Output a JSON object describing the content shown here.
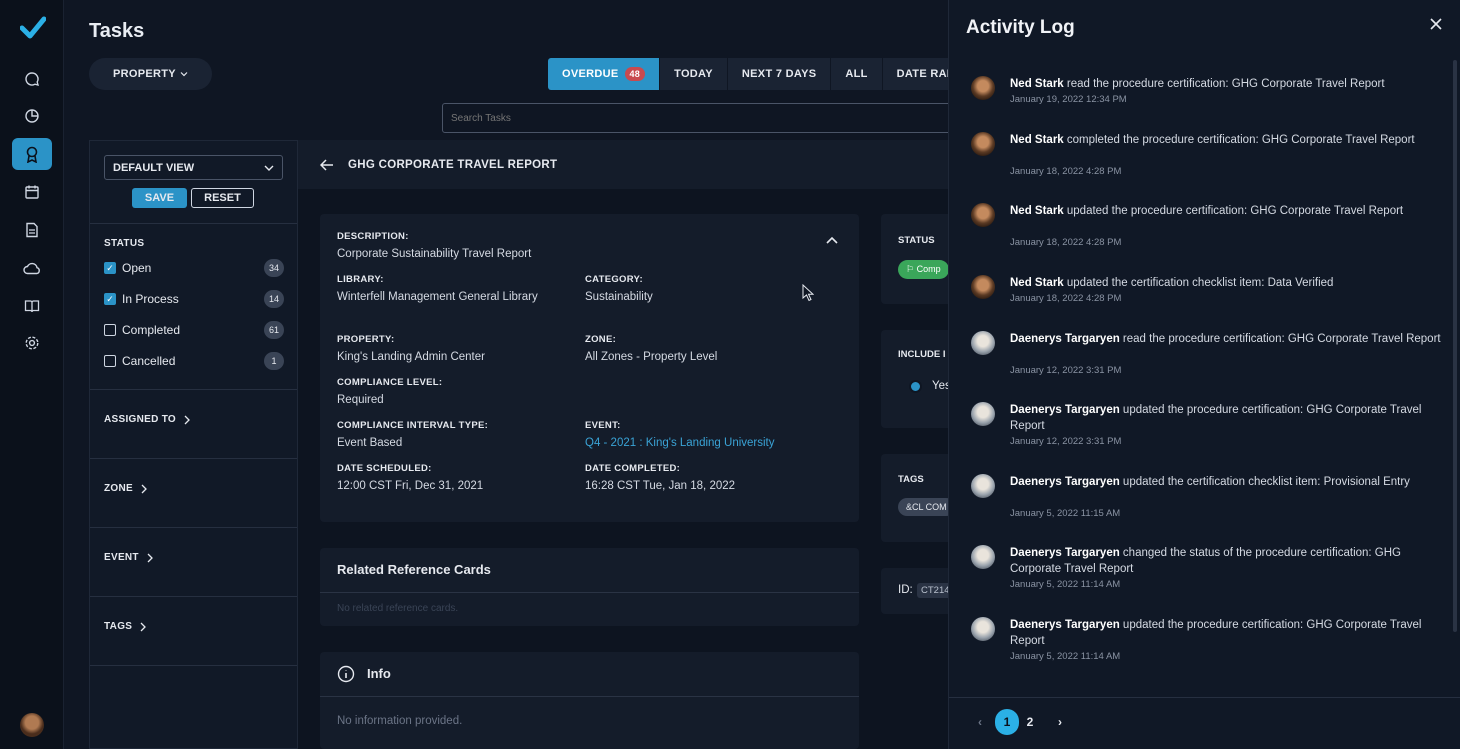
{
  "app": {
    "page_title": "Tasks",
    "property_label": "PROPERTY",
    "date_filters": {
      "overdue": "OVERDUE",
      "overdue_count": "48",
      "today": "TODAY",
      "next7": "NEXT 7 DAYS",
      "all": "ALL",
      "date_range": "DATE RANG"
    },
    "search_placeholder": "Search Tasks"
  },
  "filters": {
    "view": "DEFAULT VIEW",
    "save": "SAVE",
    "reset": "RESET",
    "status_heading": "STATUS",
    "statuses": [
      {
        "label": "Open",
        "count": "34",
        "checked": true
      },
      {
        "label": "In Process",
        "count": "14",
        "checked": true
      },
      {
        "label": "Completed",
        "count": "61",
        "checked": false
      },
      {
        "label": "Cancelled",
        "count": "1",
        "checked": false
      }
    ],
    "sections": {
      "assigned": "ASSIGNED TO",
      "zone": "ZONE",
      "event": "EVENT",
      "tags": "TAGS"
    }
  },
  "detail": {
    "title": "GHG CORPORATE TRAVEL REPORT",
    "description_label": "DESCRIPTION:",
    "description": "Corporate Sustainability Travel Report",
    "library_label": "LIBRARY:",
    "library": "Winterfell Management General Library",
    "category_label": "CATEGORY:",
    "category": "Sustainability",
    "property_label": "PROPERTY:",
    "property": "King's Landing Admin Center",
    "zone_label": "ZONE:",
    "zone": "All Zones - Property Level",
    "compliance_level_label": "COMPLIANCE LEVEL:",
    "compliance_level": "Required",
    "interval_label": "COMPLIANCE INTERVAL TYPE:",
    "interval": "Event Based",
    "event_label": "EVENT:",
    "event": "Q4 - 2021 : King's Landing University",
    "scheduled_label": "DATE SCHEDULED:",
    "scheduled": "12:00 CST Fri, Dec 31, 2021",
    "completed_label": "DATE COMPLETED:",
    "completed": "16:28 CST Tue, Jan 18, 2022",
    "related_heading": "Related Reference Cards",
    "related_empty": "No related reference cards.",
    "info_heading": "Info",
    "info_empty": "No information provided.",
    "side": {
      "status_label": "STATUS",
      "status_value": "Comp",
      "include_label": "INCLUDE I",
      "include_value": "Yes",
      "tags_label": "TAGS",
      "tag_value": "&CL COM",
      "id_label": "ID:",
      "id_value": "CT214"
    }
  },
  "activity": {
    "title": "Activity Log",
    "items": [
      {
        "user": "Ned Stark",
        "action": " read the procedure certification: GHG Corporate Travel Report",
        "time": "January 19, 2022 12:34 PM",
        "avatar": "ned"
      },
      {
        "user": "Ned Stark",
        "action": " completed the procedure certification: GHG Corporate Travel Report",
        "time": "January 18, 2022 4:28 PM",
        "avatar": "ned"
      },
      {
        "user": "Ned Stark",
        "action": " updated the procedure certification: GHG Corporate Travel Report",
        "time": "January 18, 2022 4:28 PM",
        "avatar": "ned"
      },
      {
        "user": "Ned Stark",
        "action": " updated the certification checklist item: Data Verified",
        "time": "January 18, 2022 4:28 PM",
        "avatar": "ned"
      },
      {
        "user": "Daenerys Targaryen",
        "action": " read the procedure certification: GHG Corporate Travel Report",
        "time": "January 12, 2022 3:31 PM",
        "avatar": "dany"
      },
      {
        "user": "Daenerys Targaryen",
        "action": " updated the procedure certification: GHG Corporate Travel Report",
        "time": "January 12, 2022 3:31 PM",
        "avatar": "dany"
      },
      {
        "user": "Daenerys Targaryen",
        "action": " updated the certification checklist item: Provisional Entry",
        "time": "January 5, 2022 11:15 AM",
        "avatar": "dany"
      },
      {
        "user": "Daenerys Targaryen",
        "action": " changed the status of the procedure certification: GHG Corporate Travel Report",
        "time": "January 5, 2022 11:14 AM",
        "avatar": "dany"
      },
      {
        "user": "Daenerys Targaryen",
        "action": " updated the procedure certification: GHG Corporate Travel Report",
        "time": "January 5, 2022 11:14 AM",
        "avatar": "dany"
      }
    ],
    "pager": {
      "prev": "‹",
      "next": "›",
      "pages": [
        "1",
        "2"
      ],
      "current": "1"
    }
  },
  "colors": {
    "accent": "#2b93c7",
    "background": "#0f1623",
    "badge_red": "#c94a4f",
    "success": "#3aa65a"
  }
}
